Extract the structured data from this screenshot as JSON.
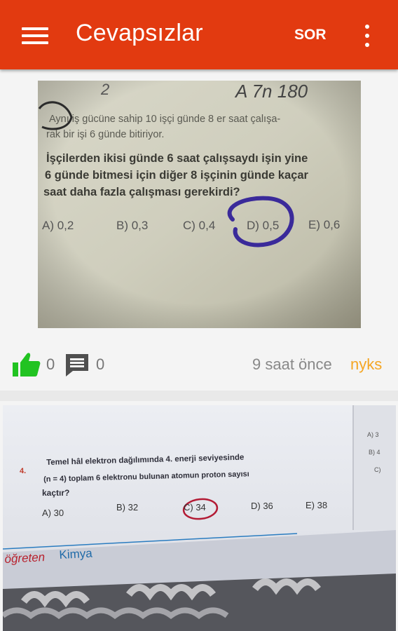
{
  "appbar": {
    "title": "Cevapsızlar",
    "ask_label": "SOR",
    "menu_icon": "hamburger-menu-icon",
    "overflow_icon": "more-vert-icon",
    "color": "#e23a10"
  },
  "posts": [
    {
      "image": {
        "top_scribble": "2",
        "top_handwriting": "A  7n  180",
        "intro_line1": "Aynı iş gücüne sahip 10 işçi günde 8 er saat çalışa-",
        "intro_line2": "rak bir işi 6 günde bitiriyor.",
        "question_line1": "İşçilerden ikisi günde 6 saat çalışsaydı işin yine",
        "question_line2": "6 günde bitmesi için diğer 8 işçinin günde kaçar",
        "question_line3": "saat daha fazla çalışması gerekirdi?",
        "options": [
          "A) 0,2",
          "B) 0,3",
          "C) 0,4",
          "D) 0,5",
          "E) 0,6"
        ],
        "circled_option": "D) 0,5"
      },
      "likes": "0",
      "comments": "0",
      "time": "9 saat önce",
      "user": "nyks",
      "like_icon_color": "#21c321"
    },
    {
      "image": {
        "question_number": "4.",
        "question_line1": "Temel hâl elektron dağılımında 4. enerji seviyesinde",
        "question_line2": "(n = 4) toplam 6 elektronu bulunan atomun proton sayısı",
        "question_line3": "kaçtır?",
        "options": [
          "A) 30",
          "B) 32",
          "C) 34",
          "D) 36",
          "E) 38"
        ],
        "circled_option": "C) 34",
        "brand_part1": "öğreten",
        "brand_part2": "Kimya"
      }
    }
  ]
}
